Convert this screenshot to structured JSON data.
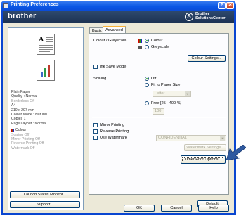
{
  "window": {
    "title": "Printing Preferences",
    "help_glyph": "?",
    "close_glyph": "✕"
  },
  "banner": {
    "brand": "brother",
    "logo_glyph": "S",
    "solutions_line1": "Brother",
    "solutions_line2": "SolutionsCenter"
  },
  "preview": {
    "doc_letter": "A",
    "settings": [
      {
        "text": "Plain Paper",
        "dim": false
      },
      {
        "text": "Quality : Normal",
        "dim": false
      },
      {
        "text": "Borderless Off",
        "dim": true
      },
      {
        "text": "A4",
        "dim": false
      },
      {
        "text": "210 x 297 mm",
        "dim": false
      },
      {
        "text": "Colour Mode : Natural",
        "dim": false
      },
      {
        "text": "Copies 1",
        "dim": false
      },
      {
        "text": "Page Layout : Normal",
        "dim": false
      }
    ],
    "colour_label": "Colour",
    "settings2": [
      "Scaling Off",
      "Mirror Printing Off",
      "Reverse Printing Off",
      "Watermark Off"
    ]
  },
  "left_buttons": {
    "launch": "Launch Status Monitor...",
    "support": "Support..."
  },
  "tabs": [
    {
      "label": "Basic"
    },
    {
      "label": "Advanced"
    }
  ],
  "advanced": {
    "colour_greyscale_label": "Colour / Greyscale",
    "colour_option": "Colour",
    "greyscale_option": "Greyscale",
    "colour_settings_button": "Colour Settings...",
    "ink_save_label": "Ink Save Mode",
    "scaling_label": "Scaling",
    "scaling_off": "Off",
    "fit_to_paper": "Fit to Paper Size",
    "paper_select": "Letter",
    "free_label": "Free [25 - 400 %]",
    "free_value": "100",
    "mirror_label": "Mirror Printing",
    "reverse_label": "Reverse Printing",
    "watermark_label": "Use Watermark",
    "watermark_select": "CONFIDENTIAL",
    "watermark_settings_button": "Watermark Settings...",
    "other_options_button": "Other Print Options...",
    "default_button": "Default"
  },
  "footer": {
    "ok": "OK",
    "cancel": "Cancel",
    "help": "Help"
  },
  "colors": {
    "title_bar": "#0a56e4",
    "banner": "#1c3252",
    "dialog_bg": "#ece9d8",
    "arrow": "#2f5aa0"
  }
}
